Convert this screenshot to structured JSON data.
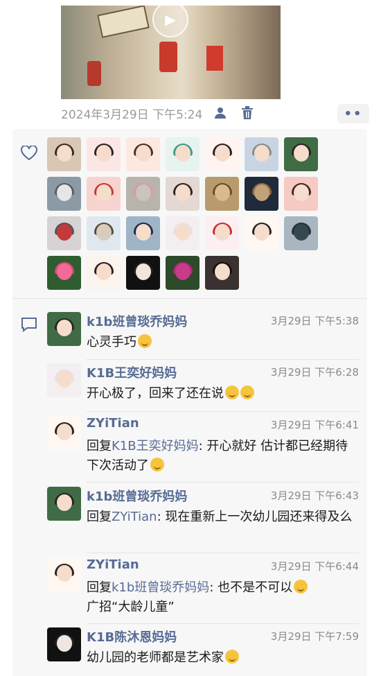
{
  "post": {
    "timestamp": "2024年3月29日 下午5:24",
    "more_label": "••"
  },
  "likes": {
    "count_rows": 4
  },
  "comments": [
    {
      "name": "k1b班曾琰乔妈妈",
      "time": "3月29日 下午5:38",
      "text": "心灵手巧",
      "emoji": "666-emoji"
    },
    {
      "name": "K1B王奕好妈妈",
      "time": "3月29日 下午6:28",
      "text": "开心极了，回来了还在说",
      "emoji": "grin-emoji"
    },
    {
      "name": "ZYiTian",
      "time": "3月29日 下午6:41",
      "reply_prefix": "回复",
      "reply_to": "K1B王奕好妈妈",
      "text": ": 开心就好 估计都已经期待下次活动了",
      "emoji": "laugh-emoji"
    },
    {
      "name": "k1b班曾琰乔妈妈",
      "time": "3月29日 下午6:43",
      "reply_prefix": "回复",
      "reply_to": "ZYiTian",
      "text": ": 现在重新上一次幼儿园还来得及么"
    },
    {
      "name": "ZYiTian",
      "time": "3月29日 下午6:44",
      "reply_prefix": "回复",
      "reply_to": "k1b班曾琰乔妈妈",
      "text": ": 也不是不可以",
      "text2": "广招“大龄儿童”",
      "emoji": "think-emoji"
    },
    {
      "name": "K1B陈沐恩妈妈",
      "time": "3月29日 下午7:59",
      "text": "幼儿园的老师都是艺术家",
      "emoji": "cry-laugh-emoji"
    }
  ],
  "colors": {
    "name_link": "#576b95",
    "panel_bg": "#f7f7f7",
    "meta_gray": "#9a9a9a"
  }
}
